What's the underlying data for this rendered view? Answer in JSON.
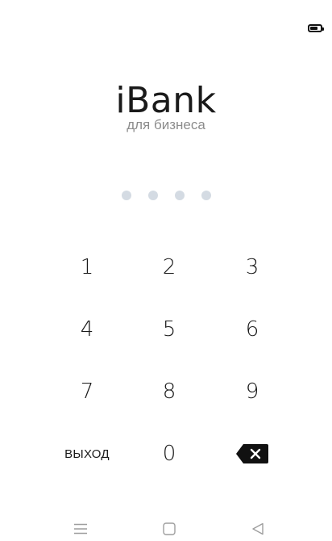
{
  "status_bar": {
    "battery_icon": "battery-icon"
  },
  "brand": {
    "title": "iBank",
    "subtitle": "для бизнеса"
  },
  "pin": {
    "entered": 0,
    "length": 4
  },
  "keypad": {
    "rows": [
      [
        "1",
        "2",
        "3"
      ],
      [
        "4",
        "5",
        "6"
      ],
      [
        "7",
        "8",
        "9"
      ]
    ],
    "exit_label": "ВЫХОД",
    "zero": "0",
    "backspace_icon": "backspace-icon"
  },
  "nav_bar": {
    "menu_icon": "menu-icon",
    "home_icon": "home-icon",
    "back_icon": "back-icon"
  },
  "colors": {
    "text": "#1a1a1a",
    "subtitle": "#8c8c8c",
    "pin_dot_empty": "#d4dbe3",
    "nav_icon": "#9e9e9e"
  }
}
